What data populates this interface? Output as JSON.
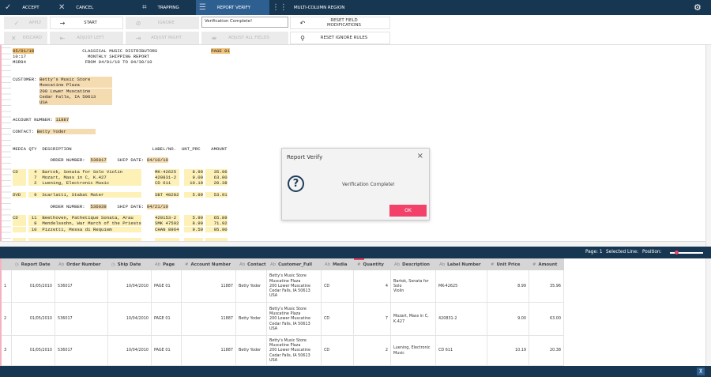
{
  "topbar": {
    "accept": "ACCEPT",
    "cancel": "CANCEL",
    "trapping": "TRAPPING",
    "report_verify": "REPORT VERIFY",
    "multi_column": "MULTI-COLUMN REGION"
  },
  "toolbar": {
    "apply": "APPLY",
    "discard": "DISCARD",
    "start": "START",
    "adjust_left": "ADJUST LEFT",
    "ignore": "IGNORE",
    "adjust_right": "ADJUST RIGHT",
    "verification_value": "Verification Complete!",
    "adjust_all": "ADJUST ALL FIELDS",
    "reset_field": "RESET FIELD MODIFICATIONS",
    "reset_ignore": "RESET IGNORE RULES"
  },
  "report": {
    "lines": [
      [
        [
          "05/01/10",
          "o"
        ],
        [
          "                  CLASSICAL MUSIC DISTRIBUTORS                    ",
          ""
        ],
        [
          "PAGE 01",
          "o"
        ]
      ],
      [
        [
          "10:17                       MONTHLY SHIPPING REPORT",
          ""
        ]
      ],
      [
        [
          "MSR94                      FROM 04/01/10 TO 04/30/10",
          ""
        ]
      ],
      [],
      [],
      [
        [
          "CUSTOMER: ",
          ""
        ],
        [
          "Betty's Music Store        ",
          "t"
        ]
      ],
      [
        [
          "          ",
          ""
        ],
        [
          "Muscatine Plaza            ",
          "t"
        ]
      ],
      [
        [
          "          ",
          ""
        ],
        [
          "200 Lower Muscatine        ",
          "t"
        ]
      ],
      [
        [
          "          ",
          ""
        ],
        [
          "Cedar Falls, IA 50613      ",
          "t"
        ]
      ],
      [
        [
          "          ",
          ""
        ],
        [
          "USA                        ",
          "t"
        ]
      ],
      [],
      [],
      [
        [
          "ACCOUNT NUMBER: ",
          ""
        ],
        [
          "11887",
          "t"
        ]
      ],
      [],
      [
        [
          "CONTACT: ",
          ""
        ],
        [
          "Betty Yoder           ",
          "t"
        ]
      ],
      [],
      [],
      [
        [
          "MEDIA QTY  DESCRIPTION                              LABEL/NO.  UNT_PRC    AMOUNT",
          ""
        ]
      ],
      [],
      [
        [
          "              ORDER NUMBER:  ",
          ""
        ],
        [
          "536017",
          "t"
        ],
        [
          "    SHIP DATE: ",
          ""
        ],
        [
          "04/10/10",
          "t"
        ]
      ],
      []
    ],
    "items1": [
      {
        "media": "CD",
        "qty": "4",
        "desc": "Bartok, Sonata for Solo Violin",
        "label": "MK-42625",
        "price": "8.99",
        "amount": "35.96"
      },
      {
        "media": "",
        "qty": "7",
        "desc": "Mozart, Mass in C, K.427",
        "label": "420831-2",
        "price": "9.00",
        "amount": "63.00"
      },
      {
        "media": "",
        "qty": "2",
        "desc": "Luening, Electronic Music",
        "label": "CD 611",
        "price": "10.19",
        "amount": "20.38"
      },
      null,
      {
        "media": "DVD",
        "qty": "9",
        "desc": "Scarlatti, Stabat Mater",
        "label": "SBT 48282",
        "price": "5.99",
        "amount": "53.91"
      },
      null
    ],
    "order2": [
      [
        "              ORDER NUMBER:  ",
        ""
      ],
      [
        "536039",
        "t"
      ],
      [
        "    SHIP DATE: ",
        ""
      ],
      [
        "04/21/10",
        "t"
      ]
    ],
    "items2": [
      null,
      {
        "media": "CD",
        "qty": "11",
        "desc": "Beethoven, Pathetique Sonata, Arau",
        "label": "420153-2",
        "price": "5.99",
        "amount": "65.89"
      },
      {
        "media": "",
        "qty": "8",
        "desc": "Mendelssohn, War March of the Priests",
        "label": "SMK 47592",
        "price": "8.99",
        "amount": "71.92"
      },
      {
        "media": "",
        "qty": "10",
        "desc": "Pizzetti, Messa di Requiem",
        "label": "CHAN 8964",
        "price": "9.59",
        "amount": "95.90"
      }
    ]
  },
  "status": {
    "page": "Page: 1",
    "selected_line": "Selected Line:",
    "position": "Position:",
    "position_value": 0.15
  },
  "grid": {
    "columns": [
      {
        "type": "◷",
        "label": "Report Date"
      },
      {
        "type": "Ab",
        "label": "Order Number"
      },
      {
        "type": "◷",
        "label": "Ship Date"
      },
      {
        "type": "Ab",
        "label": "Page"
      },
      {
        "type": "#",
        "label": "Account Number"
      },
      {
        "type": "Ab",
        "label": "Contact"
      },
      {
        "type": "Ab",
        "label": "Customer_Full"
      },
      {
        "type": "Ab",
        "label": "Media"
      },
      {
        "type": "#",
        "label": "Quantity"
      },
      {
        "type": "Ab",
        "label": "Description"
      },
      {
        "type": "Ab",
        "label": "Label Number"
      },
      {
        "type": "#",
        "label": "Unit Price"
      },
      {
        "type": "#",
        "label": "Amount"
      }
    ],
    "rows": [
      [
        "1",
        "01/05/2010",
        "536017",
        "10/04/2010",
        "PAGE 01",
        "11887",
        "Betty Yoder",
        "Betty's Music Store\nMuscatine Plaza\n200 Lower Muscatine\nCedar Falls, IA 50613\nUSA",
        "CD",
        "4",
        "Bartok, Sonata for Solo\nViolin",
        "MK-42625",
        "8.99",
        "35.96"
      ],
      [
        "2",
        "01/05/2010",
        "536017",
        "10/04/2010",
        "PAGE 01",
        "11887",
        "Betty Yoder",
        "Betty's Music Store\nMuscatine Plaza\n200 Lower Muscatine\nCedar Falls, IA 50613\nUSA",
        "CD",
        "7",
        "Mozart, Mass in C,\nK.427",
        "420831-2",
        "9.00",
        "63.00"
      ],
      [
        "3",
        "01/05/2010",
        "536017",
        "10/04/2010",
        "PAGE 01",
        "11887",
        "Betty Yoder",
        "Betty's Music Store\nMuscatine Plaza\n200 Lower Muscatine\nCedar Falls, IA 50613\nUSA",
        "CD",
        "2",
        "Luening, Electronic\nMusic",
        "CD 611",
        "10.19",
        "20.38"
      ]
    ]
  },
  "dialog": {
    "title": "Report Verify",
    "message": "Verification Complete!",
    "ok": "OK",
    "close": "×"
  },
  "colors": {
    "navy": "#163651",
    "accent": "#f2426a",
    "active_tab": "#2d5f90"
  }
}
